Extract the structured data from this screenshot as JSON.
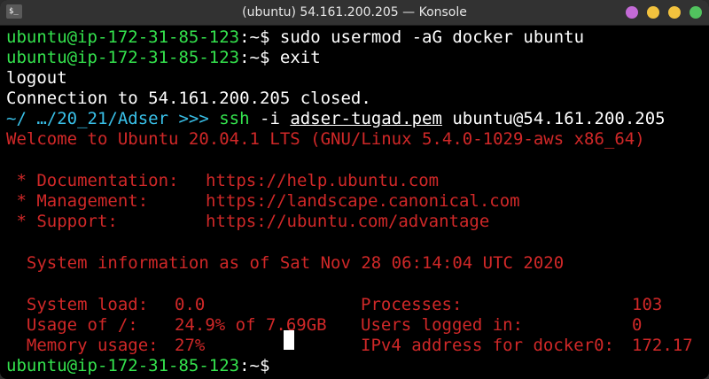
{
  "window": {
    "title": "(ubuntu) 54.161.200.205 — Konsole",
    "app_icon": "$_"
  },
  "terminal": {
    "prompt_user": "ubuntu@ip-172-31-85-123",
    "prompt_path": ":~$",
    "cmd1": " sudo usermod -aG docker ubuntu",
    "cmd2": " exit",
    "out_logout": "logout",
    "out_closed": "Connection to 54.161.200.205 closed.",
    "local_path": "~/ …/20_21/Adser",
    "local_arrows": " >>> ",
    "ssh_cmd": "ssh",
    "ssh_flag": " -i ",
    "ssh_key": "adser-tugad.pem",
    "ssh_target": " ubuntu@54.161.200.205",
    "welcome": "Welcome to Ubuntu 20.04.1 LTS (GNU/Linux 5.4.0-1029-aws x86_64)",
    "doc_label": " * Documentation:",
    "doc_url": "https://help.ubuntu.com",
    "mgmt_label": " * Management:",
    "mgmt_url": "https://landscape.canonical.com",
    "support_label": " * Support:",
    "support_url": "https://ubuntu.com/advantage",
    "sysinfo": "  System information as of Sat Nov 28 06:14:04 UTC 2020",
    "load_label": "  System load:",
    "load_value": "0.0",
    "usage_label": "  Usage of /:",
    "usage_value": "24.9% of 7.69GB",
    "mem_label": "  Memory usage:",
    "mem_value": "27%",
    "proc_label": "Processes:",
    "proc_value": "103",
    "users_label": "Users logged in:",
    "users_value": "0",
    "ipv4_label": "IPv4 address for docker0:",
    "ipv4_value": "172.17"
  }
}
